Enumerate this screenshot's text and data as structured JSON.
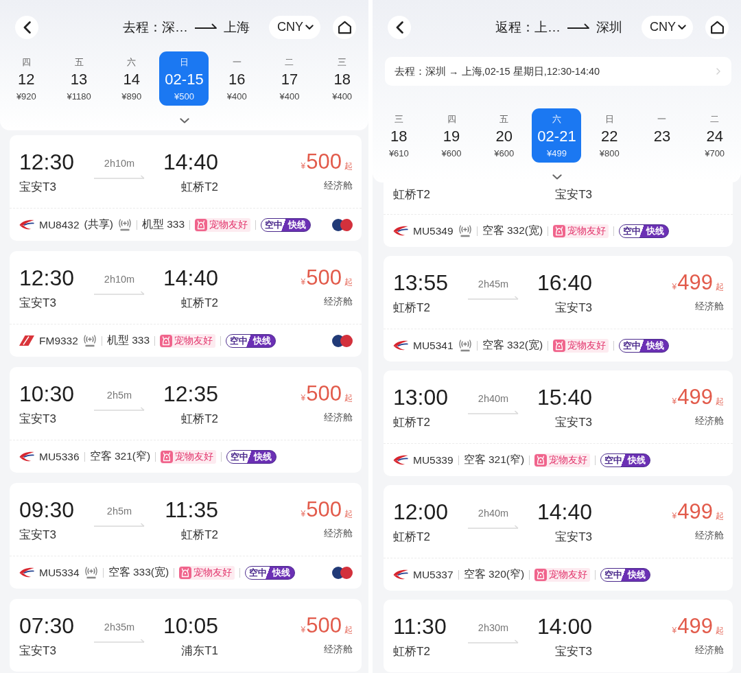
{
  "screens": [
    {
      "header": {
        "title": {
          "label": "去程：",
          "from": "深…",
          "to": "上海"
        },
        "currency": "CNY"
      },
      "dates": [
        {
          "weekday": "四",
          "day": "12",
          "price": "¥920",
          "selected": false
        },
        {
          "weekday": "五",
          "day": "13",
          "price": "¥1180",
          "selected": false
        },
        {
          "weekday": "六",
          "day": "14",
          "price": "¥890",
          "selected": false
        },
        {
          "weekday": "日",
          "day": "02-15",
          "price": "¥500",
          "selected": true
        },
        {
          "weekday": "一",
          "day": "16",
          "price": "¥400",
          "selected": false
        },
        {
          "weekday": "二",
          "day": "17",
          "price": "¥400",
          "selected": false
        },
        {
          "weekday": "三",
          "day": "18",
          "price": "¥400",
          "selected": false
        }
      ],
      "flights": [
        {
          "dep_time": "12:30",
          "duration": "2h10m",
          "arr_time": "14:40",
          "dep_airport": "宝安T3",
          "arr_airport": "虹桥T2",
          "price": {
            "currency": "¥",
            "amount": "500",
            "suffix": "起"
          },
          "cabin": "经济舱",
          "logo": {
            "kind": "swallow"
          },
          "flight_number": "MU8432",
          "codeshare": "(共享)",
          "wifi": true,
          "aircraft": "机型 333",
          "pet_tag": "宠物友好",
          "express_badge": [
            "空中",
            "快线"
          ],
          "partner_logo": true
        },
        {
          "dep_time": "12:30",
          "duration": "2h10m",
          "arr_time": "14:40",
          "dep_airport": "宝安T3",
          "arr_airport": "虹桥T2",
          "price": {
            "currency": "¥",
            "amount": "500",
            "suffix": "起"
          },
          "cabin": "经济舱",
          "logo": {
            "kind": "stripe"
          },
          "flight_number": "FM9332",
          "wifi": true,
          "aircraft": "机型 333",
          "pet_tag": "宠物友好",
          "express_badge": [
            "空中",
            "快线"
          ],
          "partner_logo": true
        },
        {
          "dep_time": "10:30",
          "duration": "2h5m",
          "arr_time": "12:35",
          "dep_airport": "宝安T3",
          "arr_airport": "虹桥T2",
          "price": {
            "currency": "¥",
            "amount": "500",
            "suffix": "起"
          },
          "cabin": "经济舱",
          "logo": {
            "kind": "swallow"
          },
          "flight_number": "MU5336",
          "wifi": false,
          "aircraft": "空客 321(窄)",
          "pet_tag": "宠物友好",
          "express_badge": [
            "空中",
            "快线"
          ],
          "partner_logo": false
        },
        {
          "dep_time": "09:30",
          "duration": "2h5m",
          "arr_time": "11:35",
          "dep_airport": "宝安T3",
          "arr_airport": "虹桥T2",
          "price": {
            "currency": "¥",
            "amount": "500",
            "suffix": "起"
          },
          "cabin": "经济舱",
          "logo": {
            "kind": "swallow"
          },
          "flight_number": "MU5334",
          "wifi": true,
          "aircraft": "空客 333(宽)",
          "pet_tag": "宠物友好",
          "express_badge": [
            "空中",
            "快线"
          ],
          "partner_logo": true
        },
        {
          "dep_time": "07:30",
          "duration": "2h35m",
          "arr_time": "10:05",
          "dep_airport": "宝安T3",
          "arr_airport": "浦东T1",
          "price": {
            "currency": "¥",
            "amount": "500",
            "suffix": "起"
          },
          "cabin": "经济舱"
        }
      ]
    },
    {
      "header": {
        "title": {
          "label": "返程：",
          "from": "上…",
          "to": "深圳"
        },
        "currency": "CNY"
      },
      "summary": "去程：深圳 → 上海,02-15 星期日,12:30-14:40",
      "dates": [
        {
          "weekday": "三",
          "day": "18",
          "price": "¥610",
          "selected": false
        },
        {
          "weekday": "四",
          "day": "19",
          "price": "¥600",
          "selected": false
        },
        {
          "weekday": "五",
          "day": "20",
          "price": "¥600",
          "selected": false
        },
        {
          "weekday": "六",
          "day": "02-21",
          "price": "¥499",
          "selected": true
        },
        {
          "weekday": "日",
          "day": "22",
          "price": "¥800",
          "selected": false
        },
        {
          "weekday": "一",
          "day": "23",
          "selected": false
        },
        {
          "weekday": "二",
          "day": "24",
          "price": "¥700",
          "selected": false
        }
      ],
      "flights": [
        {
          "dep_airport": "虹桥T2",
          "arr_airport": "宝安T3",
          "logo": {
            "kind": "swallow"
          },
          "flight_number": "MU5349",
          "wifi": true,
          "aircraft": "空客 332(宽)",
          "pet_tag": "宠物友好",
          "express_badge": [
            "空中",
            "快线"
          ],
          "partner_logo": false
        },
        {
          "dep_time": "13:55",
          "duration": "2h45m",
          "arr_time": "16:40",
          "dep_airport": "虹桥T2",
          "arr_airport": "宝安T3",
          "price": {
            "currency": "¥",
            "amount": "499",
            "suffix": "起"
          },
          "cabin": "经济舱",
          "logo": {
            "kind": "swallow"
          },
          "flight_number": "MU5341",
          "wifi": true,
          "aircraft": "空客 332(宽)",
          "pet_tag": "宠物友好",
          "express_badge": [
            "空中",
            "快线"
          ],
          "partner_logo": false
        },
        {
          "dep_time": "13:00",
          "duration": "2h40m",
          "arr_time": "15:40",
          "dep_airport": "虹桥T2",
          "arr_airport": "宝安T3",
          "price": {
            "currency": "¥",
            "amount": "499",
            "suffix": "起"
          },
          "cabin": "经济舱",
          "logo": {
            "kind": "swallow"
          },
          "flight_number": "MU5339",
          "wifi": false,
          "aircraft": "空客 321(窄)",
          "pet_tag": "宠物友好",
          "express_badge": [
            "空中",
            "快线"
          ],
          "partner_logo": false
        },
        {
          "dep_time": "12:00",
          "duration": "2h40m",
          "arr_time": "14:40",
          "dep_airport": "虹桥T2",
          "arr_airport": "宝安T3",
          "price": {
            "currency": "¥",
            "amount": "499",
            "suffix": "起"
          },
          "cabin": "经济舱",
          "logo": {
            "kind": "swallow"
          },
          "flight_number": "MU5337",
          "wifi": false,
          "aircraft": "空客 320(窄)",
          "pet_tag": "宠物友好",
          "express_badge": [
            "空中",
            "快线"
          ],
          "partner_logo": false
        },
        {
          "dep_time": "11:30",
          "duration": "2h30m",
          "arr_time": "14:00",
          "dep_airport": "虹桥T2",
          "arr_airport": "宝安T3",
          "price": {
            "currency": "¥",
            "amount": "499",
            "suffix": "起"
          },
          "cabin": "经济舱"
        }
      ]
    }
  ]
}
